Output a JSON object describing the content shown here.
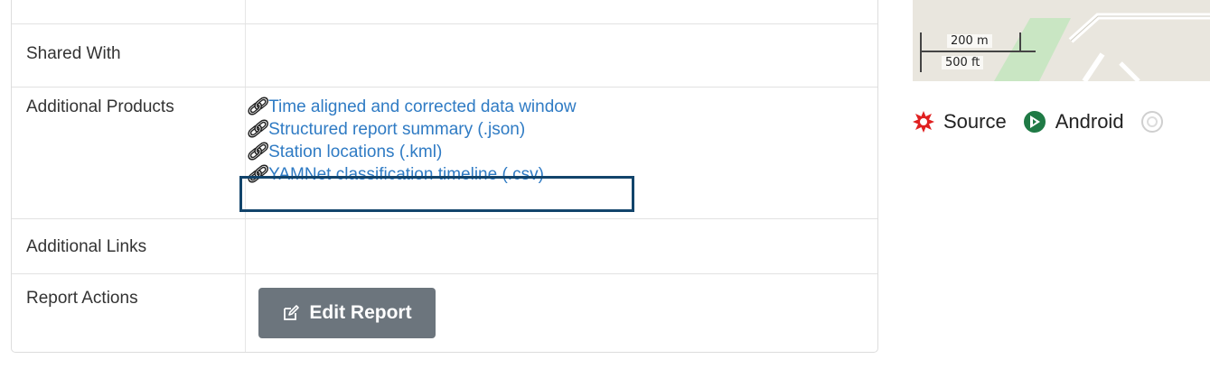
{
  "report": {
    "rows": [
      {
        "label": "Shared With"
      },
      {
        "label": "Additional Products"
      },
      {
        "label": "Additional Links"
      },
      {
        "label": "Report Actions"
      }
    ],
    "products": [
      "Time aligned and corrected data window",
      "Structured report summary (.json)",
      "Station locations (.kml)",
      "YAMNet classification timeline (.csv)"
    ],
    "edit_button": "Edit Report"
  },
  "map": {
    "scale_metric": "200 m",
    "scale_imperial": "500 ft"
  },
  "legend": {
    "items": [
      {
        "label": "Source",
        "icon": "source-burst-icon",
        "color": "#e02020"
      },
      {
        "label": "Android",
        "icon": "android-station-icon",
        "color": "#1f7a45"
      }
    ]
  },
  "colors": {
    "link": "#2f7bc4",
    "highlight": "#12446b",
    "button": "#6c757d"
  }
}
